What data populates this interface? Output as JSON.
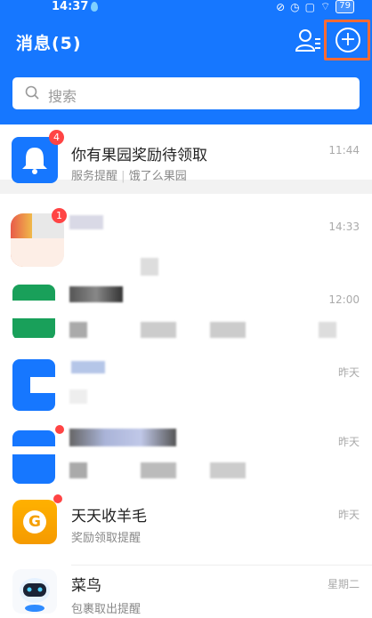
{
  "status": {
    "time": "14:37",
    "battery": "79"
  },
  "header": {
    "title": "消息(5)"
  },
  "search": {
    "placeholder": "搜索"
  },
  "pinned": {
    "title": "你有果园奖励待领取",
    "source": "服务提醒",
    "sender": "饿了么果园",
    "time": "11:44",
    "badge": "4"
  },
  "rows": [
    {
      "time": "14:33",
      "badge": "1"
    },
    {
      "time": "12:00"
    },
    {
      "time": "昨天"
    },
    {
      "time": "昨天"
    },
    {
      "title": "天天收羊毛",
      "subtitle": "奖励领取提醒",
      "time": "昨天"
    },
    {
      "title": "菜鸟",
      "subtitle": "包裹取出提醒",
      "time": "星期二"
    }
  ],
  "colors": {
    "brand": "#1677ff",
    "highlight": "#ff6a33",
    "badge": "#ff4444"
  },
  "icons": [
    "bell-icon",
    "search-icon",
    "add-icon",
    "contacts-icon"
  ]
}
